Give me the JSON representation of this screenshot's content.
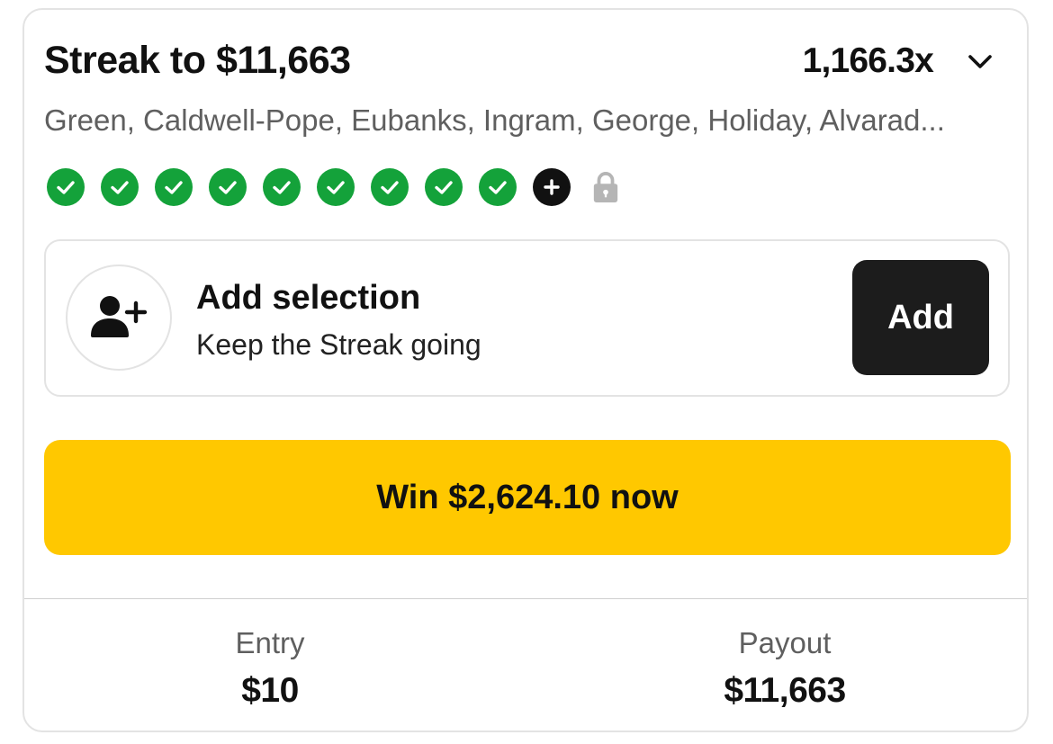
{
  "header": {
    "title": "Streak to $11,663",
    "multiplier": "1,166.3x",
    "players": "Green, Caldwell-Pope, Eubanks, Ingram, George, Holiday, Alvarad..."
  },
  "progress": {
    "completed_picks": 9,
    "icons": [
      "check-circle-icon",
      "plus-circle-icon",
      "lock-icon"
    ],
    "colors": {
      "complete": "#14a23a",
      "next": "#111111",
      "locked": "#b5b5b5"
    }
  },
  "add_selection": {
    "title": "Add selection",
    "subtitle": "Keep the Streak going",
    "button_label": "Add"
  },
  "cashout": {
    "label": "Win $2,624.10 now",
    "color": "#ffc800"
  },
  "footer": {
    "entry_label": "Entry",
    "entry_value": "$10",
    "payout_label": "Payout",
    "payout_value": "$11,663"
  }
}
